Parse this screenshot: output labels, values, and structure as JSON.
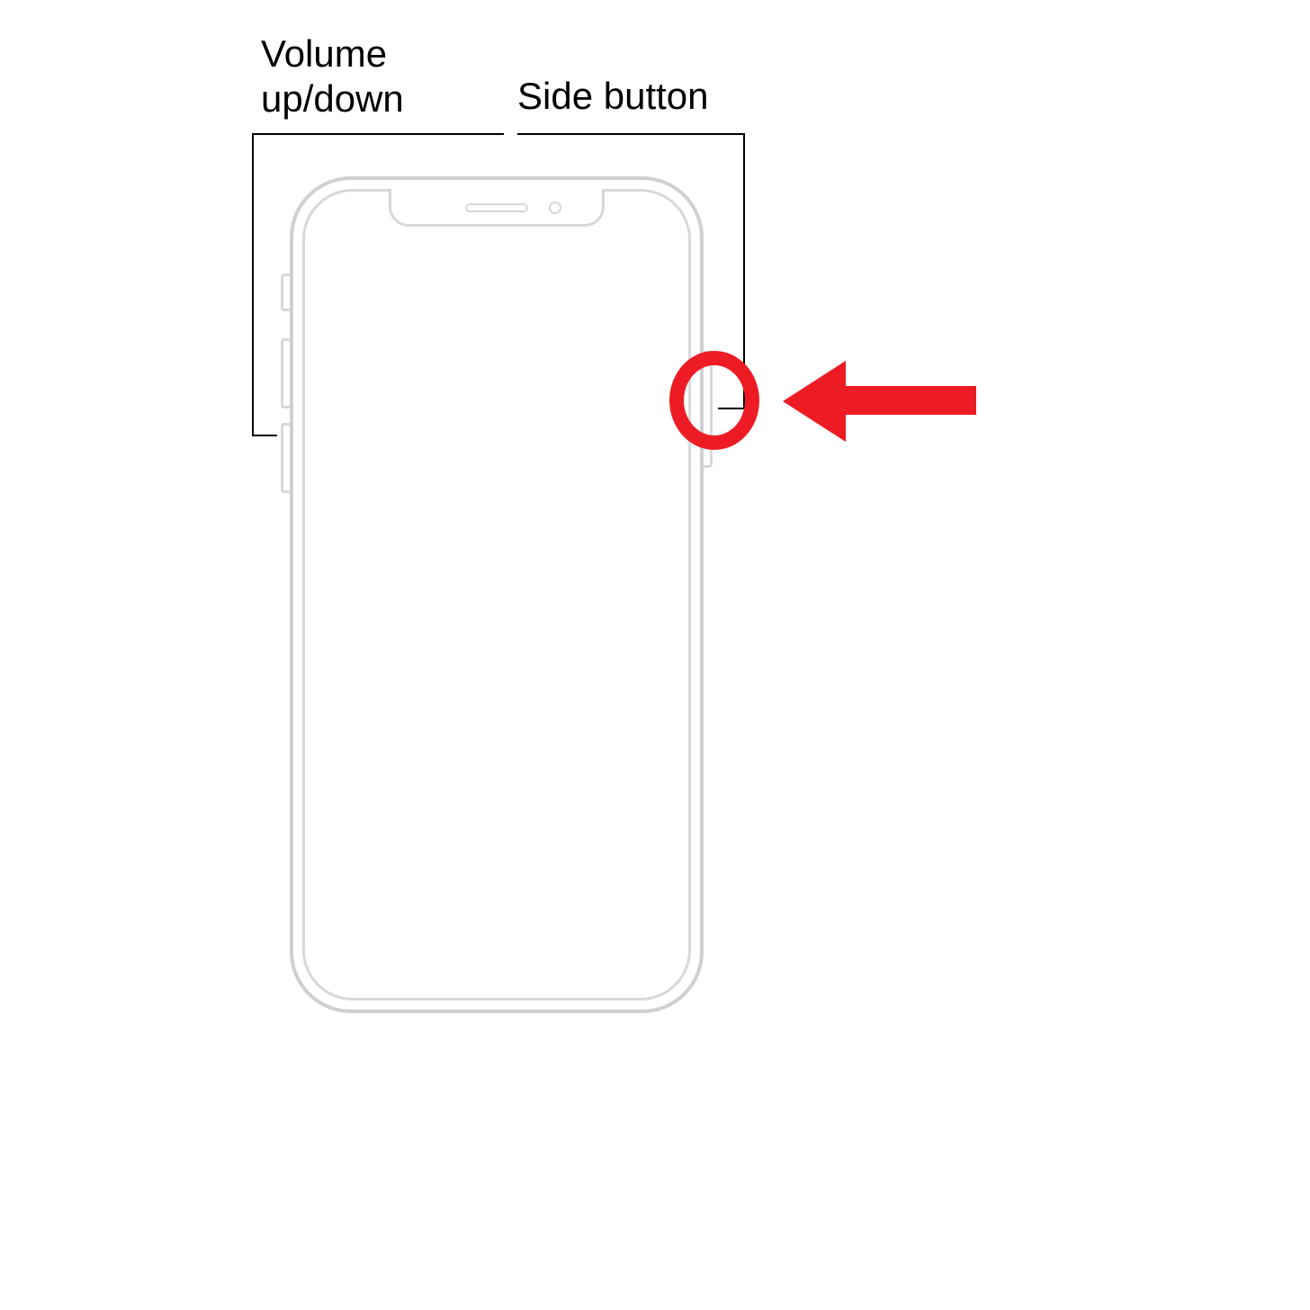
{
  "labels": {
    "volume": "Volume up/down",
    "side": "Side button"
  },
  "highlight": {
    "target": "side-button",
    "color": "#ed1c24"
  },
  "device": "iPhone (Face ID model)"
}
